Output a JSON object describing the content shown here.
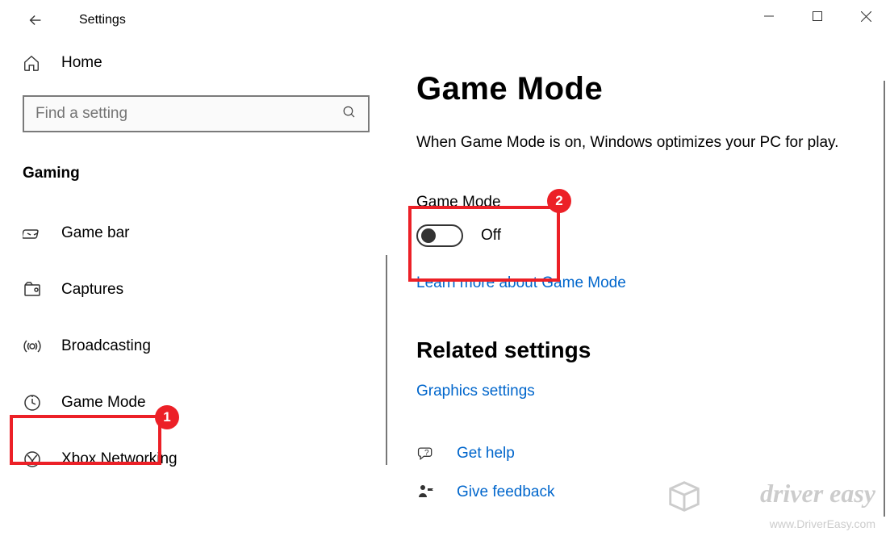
{
  "titlebar": {
    "title": "Settings"
  },
  "sidebar": {
    "home_label": "Home",
    "search_placeholder": "Find a setting",
    "section": "Gaming",
    "items": [
      {
        "label": "Game bar",
        "icon": "gamebar"
      },
      {
        "label": "Captures",
        "icon": "captures"
      },
      {
        "label": "Broadcasting",
        "icon": "broadcast"
      },
      {
        "label": "Game Mode",
        "icon": "gamemode"
      },
      {
        "label": "Xbox Networking",
        "icon": "xbox"
      }
    ]
  },
  "content": {
    "title": "Game Mode",
    "description": "When Game Mode is on, Windows optimizes your PC for play.",
    "toggle_label": "Game Mode",
    "toggle_state": "Off",
    "learn_more": "Learn more about Game Mode",
    "related_heading": "Related settings",
    "graphics_link": "Graphics settings",
    "help_link": "Get help",
    "feedback_link": "Give feedback"
  },
  "annotations": {
    "badge1": "1",
    "badge2": "2"
  },
  "watermark": {
    "brand": "driver easy",
    "url": "www.DriverEasy.com"
  }
}
